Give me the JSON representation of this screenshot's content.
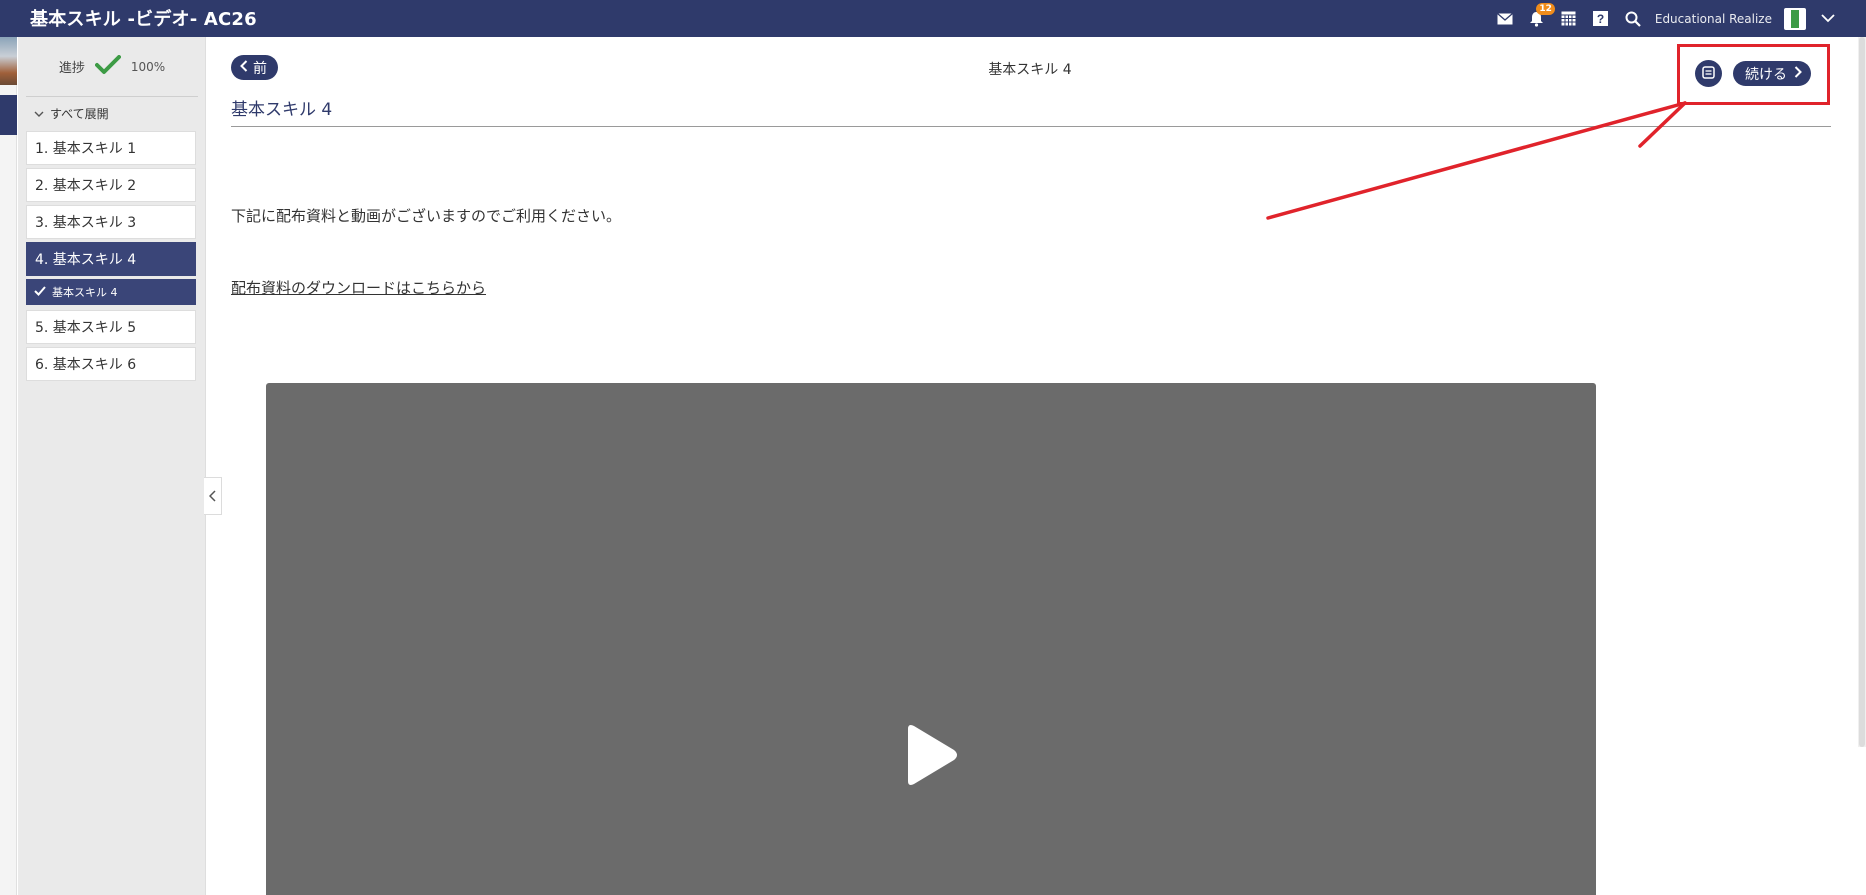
{
  "header": {
    "title": "基本スキル -ビデオ- AC26",
    "notification_count": "12",
    "user_name": "Educational Realize"
  },
  "sidebar": {
    "progress_label": "進捗",
    "progress_value": "100%",
    "expand_all_label": "すべて展開",
    "items": [
      {
        "label": "1. 基本スキル 1"
      },
      {
        "label": "2. 基本スキル 2"
      },
      {
        "label": "3. 基本スキル 3"
      },
      {
        "label": "4. 基本スキル 4"
      },
      {
        "label": "基本スキル 4"
      },
      {
        "label": "5. 基本スキル 5"
      },
      {
        "label": "6. 基本スキル 6"
      }
    ]
  },
  "main": {
    "prev_label": "前",
    "center_title": "基本スキル 4",
    "continue_label": "続ける",
    "page_title": "基本スキル 4",
    "description": "下記に配布資料と動画がございますのでご利用ください。",
    "download_link": "配布資料のダウンロードはこちらから"
  },
  "colors": {
    "brand": "#2f3a6b",
    "annotation": "#e0232b",
    "check": "#3d9b45",
    "badge": "#f08c1b"
  },
  "icons": [
    "mail-icon",
    "bell-icon",
    "calendar-icon",
    "help-icon",
    "search-icon",
    "avatar",
    "chevron-down-icon",
    "check-icon",
    "chevron-left-icon",
    "notes-icon",
    "chevron-right-icon",
    "play-icon"
  ]
}
